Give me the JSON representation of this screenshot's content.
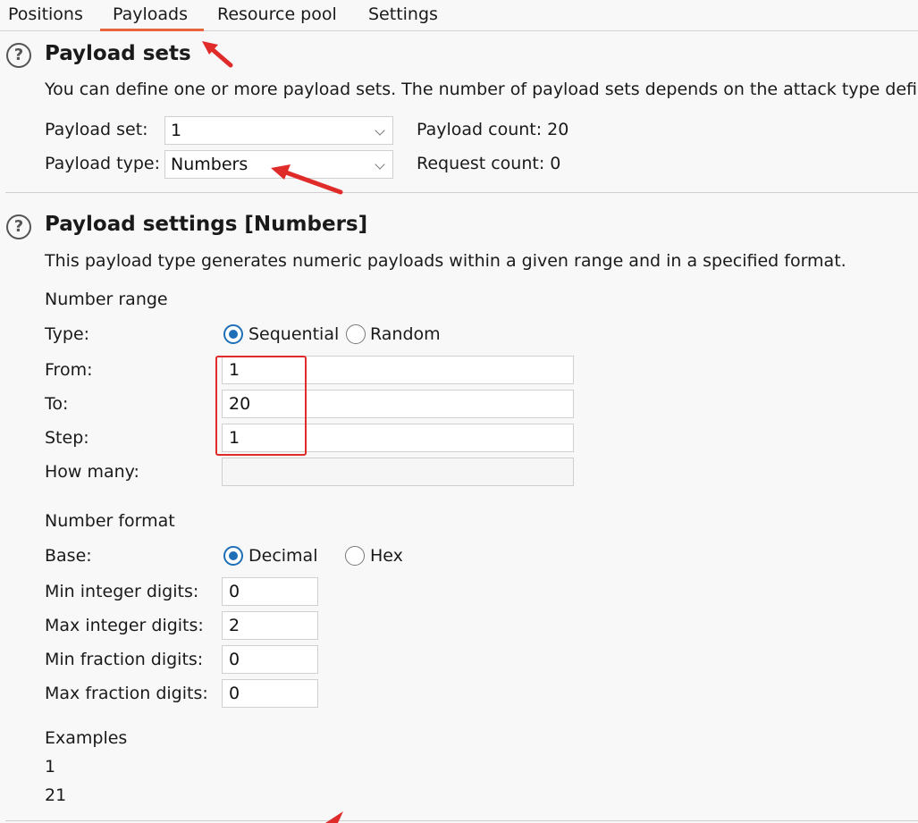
{
  "tabs": [
    {
      "label": "Positions"
    },
    {
      "label": "Payloads"
    },
    {
      "label": "Resource pool"
    },
    {
      "label": "Settings"
    }
  ],
  "payload_sets": {
    "title": "Payload sets",
    "description": "You can define one or more payload sets. The number of payload sets depends on the attack type defi",
    "payload_set_label": "Payload set:",
    "payload_set_value": "1",
    "payload_type_label": "Payload type:",
    "payload_type_value": "Numbers",
    "payload_count": "Payload count: 20",
    "request_count": "Request count: 0"
  },
  "payload_settings": {
    "title": "Payload settings [Numbers]",
    "description": "This payload type generates numeric payloads within a given range and in a specified format.",
    "number_range_heading": "Number range",
    "type_label": "Type:",
    "sequential_label": "Sequential",
    "random_label": "Random",
    "from_label": "From:",
    "from_value": "1",
    "to_label": "To:",
    "to_value": "20",
    "step_label": "Step:",
    "step_value": "1",
    "how_many_label": "How many:",
    "how_many_value": "",
    "number_format_heading": "Number format",
    "base_label": "Base:",
    "decimal_label": "Decimal",
    "hex_label": "Hex",
    "min_int_label": "Min integer digits:",
    "min_int_value": "0",
    "max_int_label": "Max integer digits:",
    "max_int_value": "2",
    "min_frac_label": "Min fraction digits:",
    "min_frac_value": "0",
    "max_frac_label": "Max fraction digits:",
    "max_frac_value": "0",
    "examples_heading": "Examples",
    "examples": [
      "1",
      "21"
    ]
  },
  "colors": {
    "accent": "#e8643a",
    "radio_selected": "#1f6fb8",
    "annotation_red": "#e02b2b"
  },
  "icons": {
    "help": "help-circle-icon",
    "dropdown": "chevron-down-icon",
    "annotation": "red-arrow-icon"
  }
}
